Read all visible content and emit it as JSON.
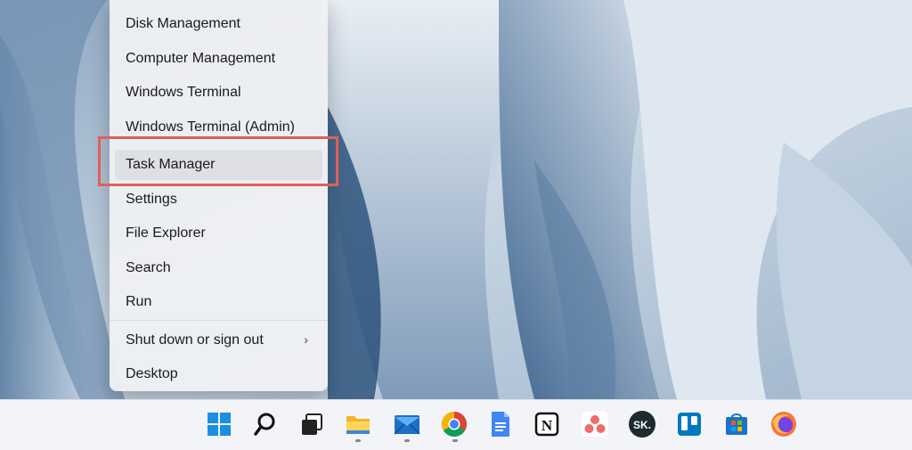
{
  "menu": {
    "items": [
      {
        "label": "Disk Management"
      },
      {
        "label": "Computer Management"
      },
      {
        "label": "Windows Terminal"
      },
      {
        "label": "Windows Terminal (Admin)"
      },
      {
        "label": "Task Manager"
      },
      {
        "label": "Settings"
      },
      {
        "label": "File Explorer"
      },
      {
        "label": "Search"
      },
      {
        "label": "Run"
      },
      {
        "label": "Shut down or sign out"
      },
      {
        "label": "Desktop"
      }
    ],
    "submenu_glyph": "›"
  },
  "taskbar": {
    "pinned": [
      {
        "name": "windows-start",
        "label": ""
      },
      {
        "name": "search",
        "label": ""
      },
      {
        "name": "task-view",
        "label": ""
      },
      {
        "name": "file-explorer",
        "label": ""
      },
      {
        "name": "mail",
        "label": ""
      },
      {
        "name": "chrome",
        "label": ""
      },
      {
        "name": "google-docs",
        "label": ""
      },
      {
        "name": "notion",
        "label": "N"
      },
      {
        "name": "asana",
        "label": ""
      },
      {
        "name": "skitch",
        "label": "SK."
      },
      {
        "name": "trello",
        "label": ""
      },
      {
        "name": "microsoft-store",
        "label": ""
      },
      {
        "name": "firefox",
        "label": ""
      }
    ]
  },
  "colors": {
    "highlight": "#e06055",
    "taskbar": "#f2f4f8"
  }
}
